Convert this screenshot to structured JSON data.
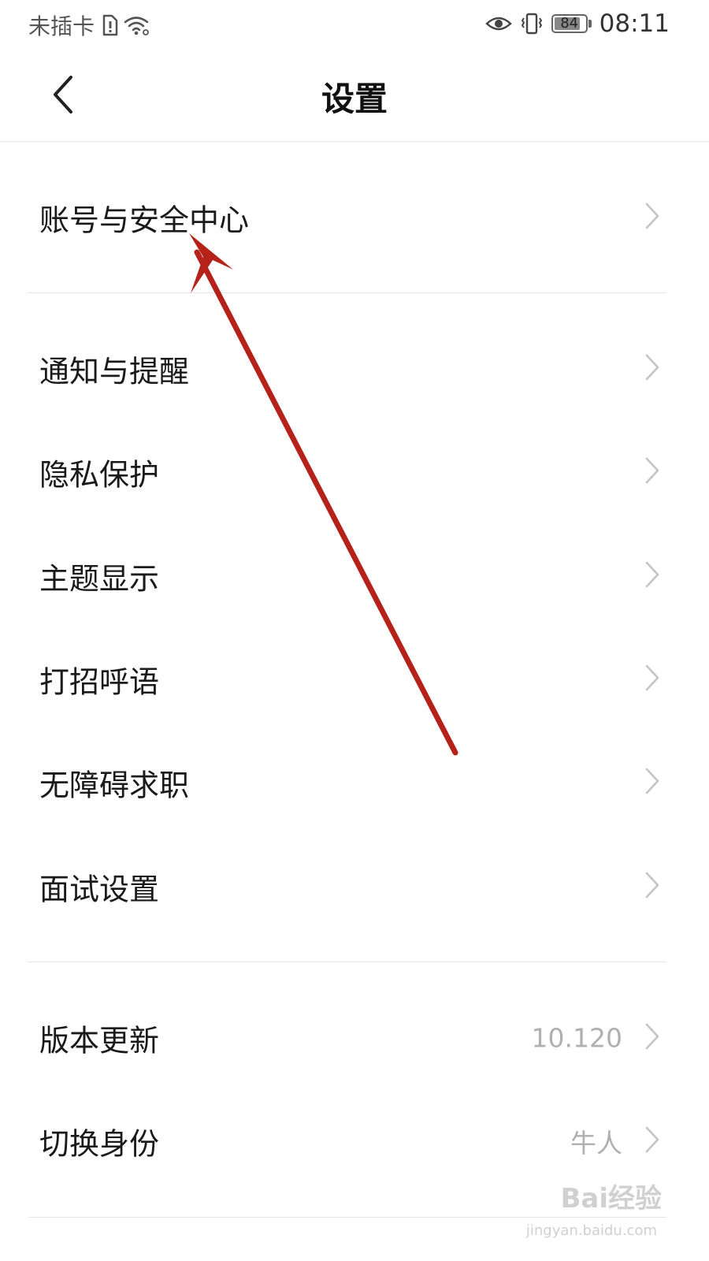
{
  "status_bar": {
    "carrier": "未插卡",
    "battery": "84",
    "battery_level": 0.84,
    "time": "08:11",
    "icons": [
      "sim-alert-icon",
      "wifi-icon",
      "eye-icon",
      "vibrate-icon",
      "battery-icon"
    ]
  },
  "header": {
    "title": "设置",
    "back_icon": "chevron-left-icon"
  },
  "settings": {
    "items": [
      {
        "label": "账号与安全中心",
        "value": ""
      },
      {
        "label": "通知与提醒",
        "value": ""
      },
      {
        "label": "隐私保护",
        "value": ""
      },
      {
        "label": "主题显示",
        "value": ""
      },
      {
        "label": "打招呼语",
        "value": ""
      },
      {
        "label": "无障碍求职",
        "value": ""
      },
      {
        "label": "面试设置",
        "value": ""
      },
      {
        "label": "版本更新",
        "value": "10.120"
      },
      {
        "label": "切换身份",
        "value": "牛人"
      }
    ]
  },
  "annotation": {
    "color": "#b5221a"
  },
  "watermark": {
    "text": "Bai经验",
    "sub": "jingyan.baidu.com"
  }
}
